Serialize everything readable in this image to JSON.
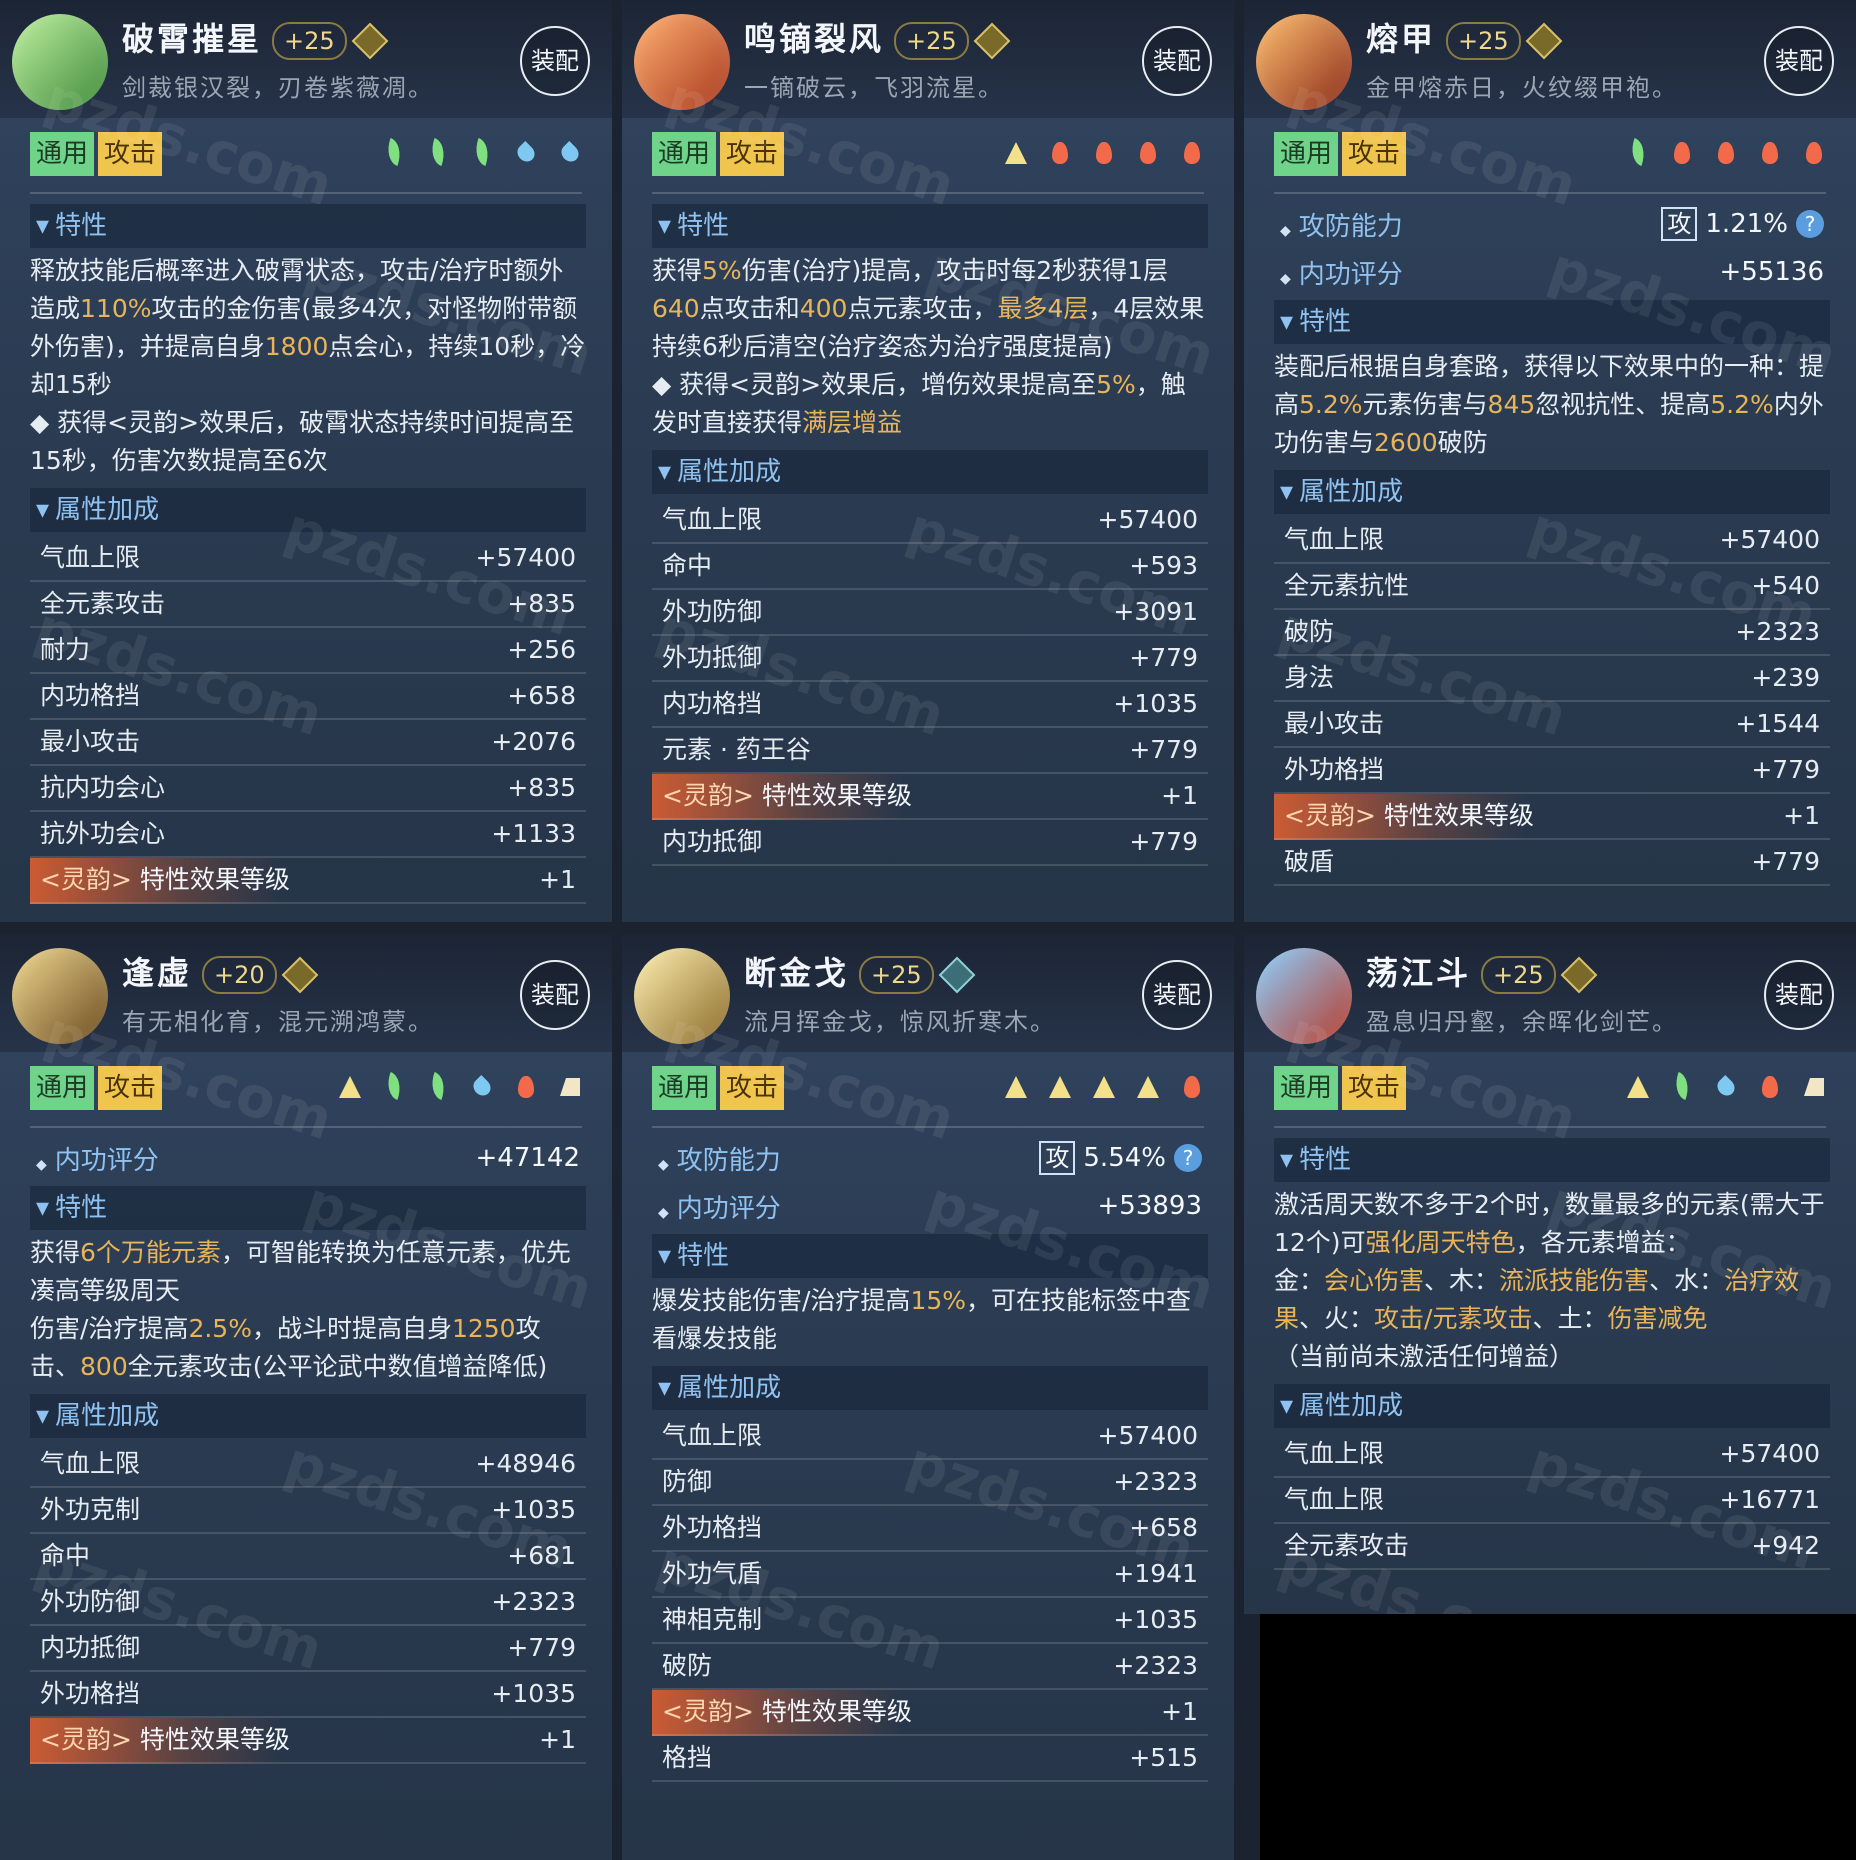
{
  "equip_label": "装配",
  "tag_general": "通用",
  "tag_attack": "攻击",
  "sections": {
    "traits": "特性",
    "bonus": "属性加成"
  },
  "watermark": "pzds.com",
  "cards": [
    {
      "name": "破霄摧星",
      "level": "+25",
      "gem": "gold",
      "desc": "剑裁银汉裂，刃卷紫薇凋。",
      "elements": [
        "leaf",
        "leaf",
        "leaf",
        "water",
        "water"
      ],
      "trait_html": "释放技能后概率进入破霄状态，攻击/治疗时额外造成<span class='hl'>110%</span>攻击的金伤害(最多4次，对怪物附带额外伤害)，并提高自身<span class='hl'>1800</span>点会心，持续10秒，冷却15秒<br>◆ 获得&lt;灵韵&gt;效果后，破霄状态持续时间提高至15秒，伤害次数提高至6次",
      "stats": [
        {
          "k": "气血上限",
          "v": "+57400"
        },
        {
          "k": "全元素攻击",
          "v": "+835"
        },
        {
          "k": "耐力",
          "v": "+256"
        },
        {
          "k": "内功格挡",
          "v": "+658"
        },
        {
          "k": "最小攻击",
          "v": "+2076"
        },
        {
          "k": "抗内功会心",
          "v": "+835"
        },
        {
          "k": "抗外功会心",
          "v": "+1133"
        },
        {
          "k": "<灵韵> 特性效果等级",
          "v": "+1",
          "ly": true
        }
      ]
    },
    {
      "name": "鸣镝裂风",
      "level": "+25",
      "gem": "gold",
      "desc": "一镝破云，飞羽流星。",
      "elements": [
        "earth",
        "fire",
        "fire",
        "fire",
        "fire"
      ],
      "trait_html": "获得<span class='hl'>5%</span>伤害(治疗)提高，攻击时每2秒获得1层<span class='hl'>640</span>点攻击和<span class='hl'>400</span>点元素攻击，<span class='hl'>最多4层</span>，4层效果持续6秒后清空(治疗姿态为治疗强度提高)<br>◆ 获得&lt;灵韵&gt;效果后，增伤效果提高至<span class='hl'>5%</span>，触发时直接获得<span class='hl'>满层增益</span>",
      "stats": [
        {
          "k": "气血上限",
          "v": "+57400"
        },
        {
          "k": "命中",
          "v": "+593"
        },
        {
          "k": "外功防御",
          "v": "+3091"
        },
        {
          "k": "外功抵御",
          "v": "+779"
        },
        {
          "k": "内功格挡",
          "v": "+1035"
        },
        {
          "k": "元素 · 药王谷",
          "v": "+779"
        },
        {
          "k": "<灵韵> 特性效果等级",
          "v": "+1",
          "ly": true
        },
        {
          "k": "内功抵御",
          "v": "+779"
        }
      ]
    },
    {
      "name": "熔甲",
      "level": "+25",
      "gem": "gold",
      "desc": "金甲熔赤日，火纹缀甲袍。",
      "elements": [
        "leaf",
        "fire",
        "fire",
        "fire",
        "fire"
      ],
      "attack_power": {
        "label": "攻防能力",
        "box": "攻",
        "value": "1.21%"
      },
      "inner_score": {
        "label": "内功评分",
        "value": "+55136"
      },
      "trait_html": "装配后根据自身套路，获得以下效果中的一种：提高<span class='hl'>5.2%</span>元素伤害与<span class='hl'>845</span>忽视抗性、提高<span class='hl'>5.2%</span>内外功伤害与<span class='hl'>2600</span>破防",
      "stats": [
        {
          "k": "气血上限",
          "v": "+57400"
        },
        {
          "k": "全元素抗性",
          "v": "+540"
        },
        {
          "k": "破防",
          "v": "+2323"
        },
        {
          "k": "身法",
          "v": "+239"
        },
        {
          "k": "最小攻击",
          "v": "+1544"
        },
        {
          "k": "外功格挡",
          "v": "+779"
        },
        {
          "k": "<灵韵> 特性效果等级",
          "v": "+1",
          "ly": true
        },
        {
          "k": "破盾",
          "v": "+779"
        }
      ]
    },
    {
      "name": "逢虚",
      "level": "+20",
      "gem": "gold",
      "desc": "有无相化育，混元溯鸿蒙。",
      "elements": [
        "earth",
        "leaf",
        "leaf",
        "water",
        "fire",
        "metal"
      ],
      "inner_score": {
        "label": "内功评分",
        "value": "+47142"
      },
      "trait_html": "获得<span class='hl'>6个万能元素</span>，可智能转换为任意元素，优先凑高等级周天<br>伤害/治疗提高<span class='hl'>2.5%</span>，战斗时提高自身<span class='hl'>1250</span>攻击、<span class='hl'>800</span>全元素攻击(公平论武中数值增益降低)",
      "stats": [
        {
          "k": "气血上限",
          "v": "+48946"
        },
        {
          "k": "外功克制",
          "v": "+1035"
        },
        {
          "k": "命中",
          "v": "+681"
        },
        {
          "k": "外功防御",
          "v": "+2323"
        },
        {
          "k": "内功抵御",
          "v": "+779"
        },
        {
          "k": "外功格挡",
          "v": "+1035"
        },
        {
          "k": "<灵韵> 特性效果等级",
          "v": "+1",
          "ly": true
        }
      ]
    },
    {
      "name": "断金戈",
      "level": "+25",
      "gem": "blue",
      "desc": "流月挥金戈，惊风折寒木。",
      "elements": [
        "earth",
        "earth",
        "earth",
        "earth",
        "fire"
      ],
      "attack_power": {
        "label": "攻防能力",
        "box": "攻",
        "value": "5.54%"
      },
      "inner_score": {
        "label": "内功评分",
        "value": "+53893"
      },
      "trait_html": "爆发技能伤害/治疗提高<span class='hl'>15%</span>，可在技能标签中查看爆发技能",
      "stats": [
        {
          "k": "气血上限",
          "v": "+57400"
        },
        {
          "k": "防御",
          "v": "+2323"
        },
        {
          "k": "外功格挡",
          "v": "+658"
        },
        {
          "k": "外功气盾",
          "v": "+1941"
        },
        {
          "k": "神相克制",
          "v": "+1035"
        },
        {
          "k": "破防",
          "v": "+2323"
        },
        {
          "k": "<灵韵> 特性效果等级",
          "v": "+1",
          "ly": true
        },
        {
          "k": "格挡",
          "v": "+515"
        }
      ]
    },
    {
      "name": "荡江斗",
      "level": "+25",
      "gem": "gold",
      "desc": "盈息归丹壑，余晖化剑芒。",
      "elements": [
        "earth",
        "leaf",
        "water",
        "fire",
        "metal"
      ],
      "trait_html": "激活周天数不多于2个时，数量最多的元素(需大于12个)可<span class='hl'>强化周天特色</span>，各元素增益：<br>金：<span class='hl'>会心伤害</span>、木：<span class='hl'>流派技能伤害</span>、水：<span class='hl'>治疗效果</span>、火：<span class='hl'>攻击/元素攻击</span>、土：<span class='hl'>伤害减免</span><br>（当前尚未激活任何增益）",
      "stats": [
        {
          "k": "气血上限",
          "v": "+57400"
        },
        {
          "k": "气血上限",
          "v": "+16771"
        },
        {
          "k": "全元素攻击",
          "v": "+942"
        }
      ]
    }
  ]
}
